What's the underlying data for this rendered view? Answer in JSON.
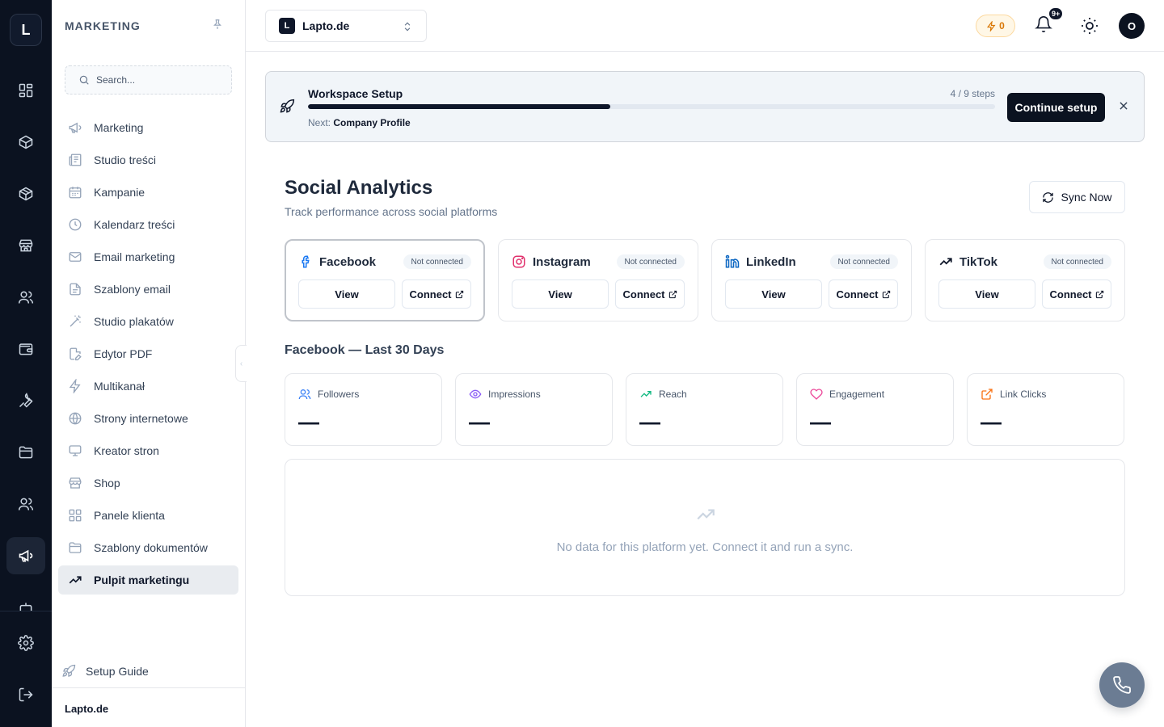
{
  "rail": {
    "logo": "L",
    "icons": [
      "grid-icon",
      "box-icon",
      "package-icon",
      "store-icon",
      "users-icon",
      "wallet-icon",
      "wrench-icon",
      "folder-icon",
      "team-icon",
      "megaphone-icon",
      "robot-icon",
      "settings-icon",
      "logout-icon"
    ]
  },
  "sidebar": {
    "title": "MARKETING",
    "search_placeholder": "Search...",
    "items": [
      {
        "label": "Marketing",
        "icon": "megaphone-icon"
      },
      {
        "label": "Studio treści",
        "icon": "newspaper-icon"
      },
      {
        "label": "Kampanie",
        "icon": "calendar-icon"
      },
      {
        "label": "Kalendarz treści",
        "icon": "clock-icon"
      },
      {
        "label": "Email marketing",
        "icon": "mail-icon"
      },
      {
        "label": "Szablony email",
        "icon": "file-text-icon"
      },
      {
        "label": "Studio plakatów",
        "icon": "wand-icon"
      },
      {
        "label": "Edytor PDF",
        "icon": "file-edit-icon"
      },
      {
        "label": "Multikanał",
        "icon": "zap-icon"
      },
      {
        "label": "Strony internetowe",
        "icon": "globe-icon"
      },
      {
        "label": "Kreator stron",
        "icon": "monitor-icon"
      },
      {
        "label": "Shop",
        "icon": "store-icon"
      },
      {
        "label": "Panele klienta",
        "icon": "grid-icon"
      },
      {
        "label": "Szablony dokumentów",
        "icon": "folder-icon"
      },
      {
        "label": "Pulpit marketingu",
        "icon": "trending-up-icon",
        "active": true
      }
    ],
    "setup_guide": "Setup Guide",
    "footer": "Lapto.de"
  },
  "header": {
    "workspace_logo": "L",
    "workspace_name": "Lapto.de",
    "credits": "0",
    "notifications_badge": "9+",
    "avatar": "O"
  },
  "banner": {
    "title": "Workspace Setup",
    "steps": "4 / 9 steps",
    "progress": 0.44,
    "next_label": "Next:",
    "next_value": "Company Profile",
    "cta": "Continue setup"
  },
  "page": {
    "title": "Social Analytics",
    "subtitle": "Track performance across social platforms",
    "sync_label": "Sync Now"
  },
  "platforms": [
    {
      "name": "Facebook",
      "status": "Not connected",
      "view": "View",
      "connect": "Connect",
      "icon": "facebook-icon",
      "color": "#1877f2"
    },
    {
      "name": "Instagram",
      "status": "Not connected",
      "view": "View",
      "connect": "Connect",
      "icon": "instagram-icon",
      "color": "#e1306c"
    },
    {
      "name": "LinkedIn",
      "status": "Not connected",
      "view": "View",
      "connect": "Connect",
      "icon": "linkedin-icon",
      "color": "#0a66c2"
    },
    {
      "name": "TikTok",
      "status": "Not connected",
      "view": "View",
      "connect": "Connect",
      "icon": "trending-up-icon",
      "color": "#0f172a"
    }
  ],
  "section": {
    "title": "Facebook — Last 30 Days"
  },
  "metrics": [
    {
      "label": "Followers",
      "value": "—",
      "icon": "users-icon",
      "color": "#3b82f6"
    },
    {
      "label": "Impressions",
      "value": "—",
      "icon": "eye-icon",
      "color": "#8b5cf6"
    },
    {
      "label": "Reach",
      "value": "—",
      "icon": "trending-up-icon",
      "color": "#10b981"
    },
    {
      "label": "Engagement",
      "value": "—",
      "icon": "heart-icon",
      "color": "#ec4899"
    },
    {
      "label": "Link Clicks",
      "value": "—",
      "icon": "external-link-icon",
      "color": "#f97316"
    }
  ],
  "empty_state": {
    "text": "No data for this platform yet. Connect it and run a sync."
  }
}
